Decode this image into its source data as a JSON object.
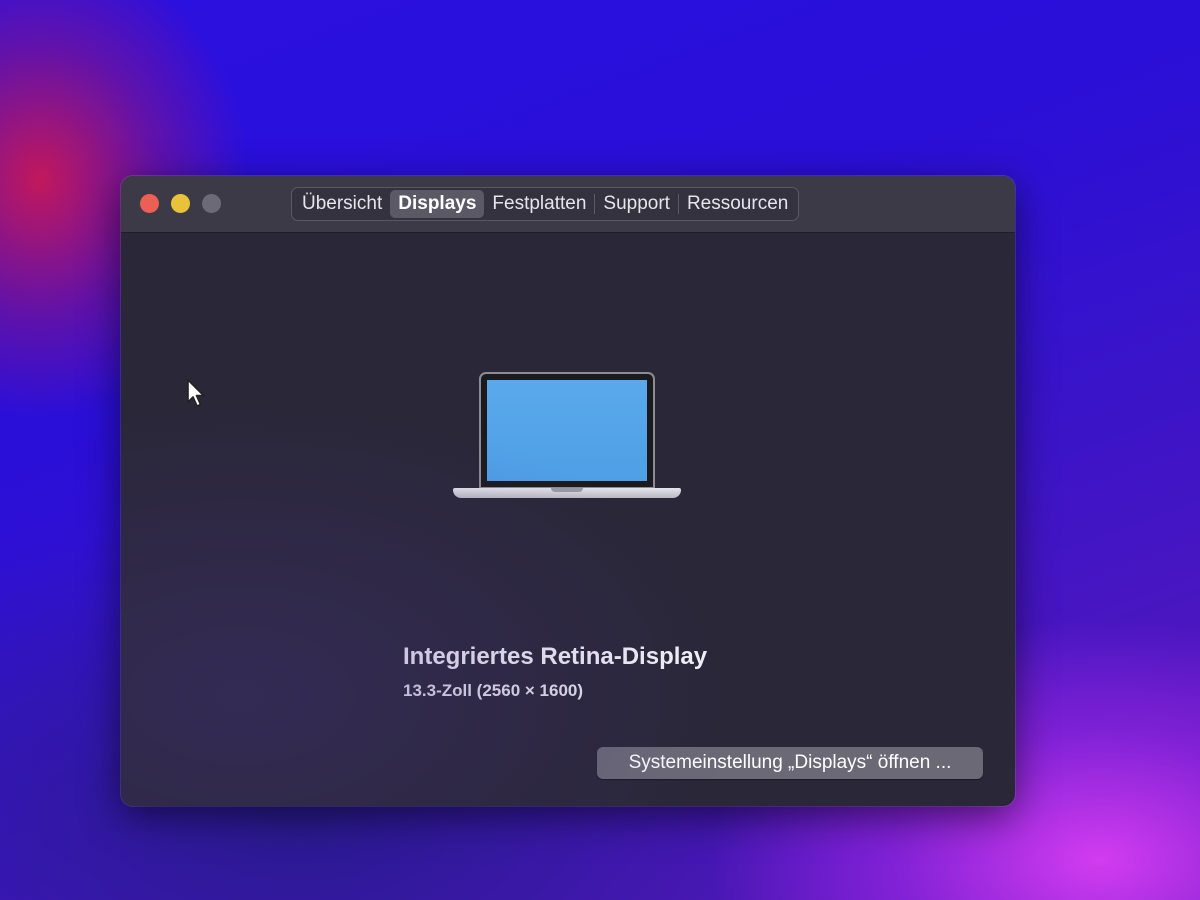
{
  "window": {
    "tabs": [
      {
        "label": "Übersicht",
        "active": false
      },
      {
        "label": "Displays",
        "active": true
      },
      {
        "label": "Festplatten",
        "active": false
      },
      {
        "label": "Support",
        "active": false
      },
      {
        "label": "Ressourcen",
        "active": false
      }
    ]
  },
  "display": {
    "name": "Integriertes Retina-Display",
    "spec": "13.3-Zoll (2560 × 1600)",
    "open_settings_label": "Systemeinstellung „Displays“ öffnen ..."
  },
  "colors": {
    "close": "#ec5f55",
    "minimize": "#e8c33a",
    "zoom_inactive": "#6b6a76",
    "window_background": "#2a2738",
    "screen": "#5aa9ec"
  },
  "icons": {
    "laptop": "laptop-icon",
    "cursor": "mouse-pointer-icon"
  }
}
